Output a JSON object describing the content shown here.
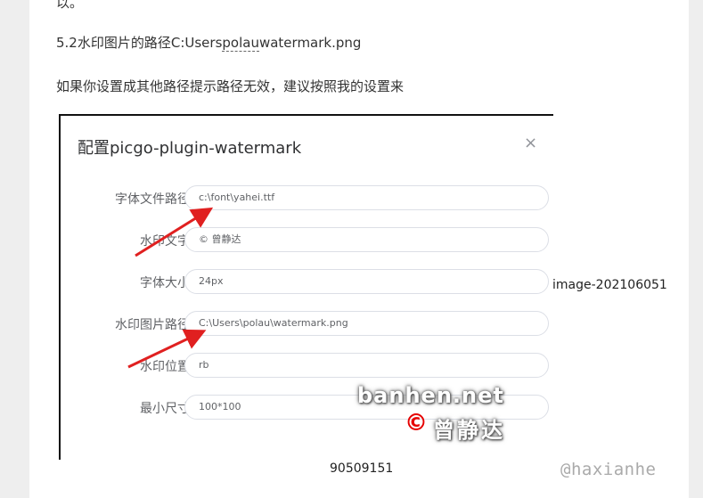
{
  "article": {
    "top_fragment": "以。",
    "heading_prefix": "5.2水印图片的路径C:Users",
    "heading_dashed": "polau",
    "heading_suffix": "watermark.png",
    "body_text": "如果你设置成其他路径提示路径无效，建议按照我的设置来",
    "caption_right": "image-202106051",
    "caption_bottom": "90509151",
    "author_tag": "@haxianhe"
  },
  "dialog": {
    "title": "配置picgo-plugin-watermark",
    "close_icon": "×",
    "fields": [
      {
        "label": "字体文件路径",
        "value": "c:\\font\\yahei.ttf"
      },
      {
        "label": "水印文字",
        "value": "© 曾静达"
      },
      {
        "label": "字体大小",
        "value": "24px"
      },
      {
        "label": "水印图片路径",
        "value": "C:\\Users\\polau\\watermark.png"
      },
      {
        "label": "水印位置",
        "value": "rb"
      },
      {
        "label": "最小尺寸",
        "value": "100*100"
      }
    ]
  },
  "watermark_overlay": {
    "line1": "banhen.net",
    "copyright_symbol": "©",
    "line2": "曾静达"
  },
  "colors": {
    "arrow": "#e02020",
    "watermark_red": "#e60000"
  }
}
